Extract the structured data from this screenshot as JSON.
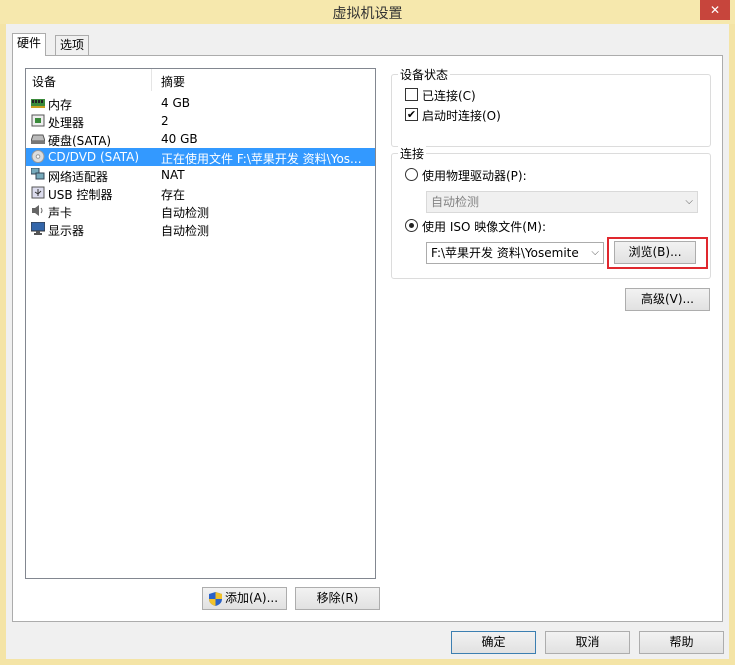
{
  "window": {
    "title": "虚拟机设置",
    "close_label": "✕"
  },
  "tabs": [
    {
      "label": "硬件"
    },
    {
      "label": "选项"
    }
  ],
  "device_list": {
    "columns": [
      "设备",
      "摘要"
    ],
    "rows": [
      {
        "name": "内存",
        "summary": "4 GB",
        "icon": "memory-icon"
      },
      {
        "name": "处理器",
        "summary": "2",
        "icon": "processor-icon"
      },
      {
        "name": "硬盘(SATA)",
        "summary": "40 GB",
        "icon": "hard-disk-icon"
      },
      {
        "name": "CD/DVD (SATA)",
        "summary": "正在使用文件 F:\\苹果开发 资料\\Yos...",
        "icon": "cd-dvd-icon"
      },
      {
        "name": "网络适配器",
        "summary": "NAT",
        "icon": "network-adapter-icon"
      },
      {
        "name": "USB 控制器",
        "summary": "存在",
        "icon": "usb-icon"
      },
      {
        "name": "声卡",
        "summary": "自动检测",
        "icon": "speaker-icon"
      },
      {
        "name": "显示器",
        "summary": "自动检测",
        "icon": "monitor-icon"
      }
    ]
  },
  "list_buttons": {
    "add": "添加(A)...",
    "remove": "移除(R)"
  },
  "device_status": {
    "legend": "设备状态",
    "connected": "已连接(C)",
    "connect_at_power_on": "启动时连接(O)"
  },
  "connection": {
    "legend": "连接",
    "physical_drive": "使用物理驱动器(P):",
    "physical_drive_value": "自动检测",
    "iso_image": "使用 ISO 映像文件(M):",
    "iso_path": "F:\\苹果开发 资料\\Yosemite",
    "browse": "浏览(B)..."
  },
  "advanced_button": "高级(V)...",
  "footer": {
    "ok": "确定",
    "cancel": "取消",
    "help": "帮助"
  },
  "colors": {
    "selection": "#3399ff",
    "highlight_box": "#e0282e",
    "titlebar": "#f6e8ad",
    "close_button": "#c7453c"
  }
}
